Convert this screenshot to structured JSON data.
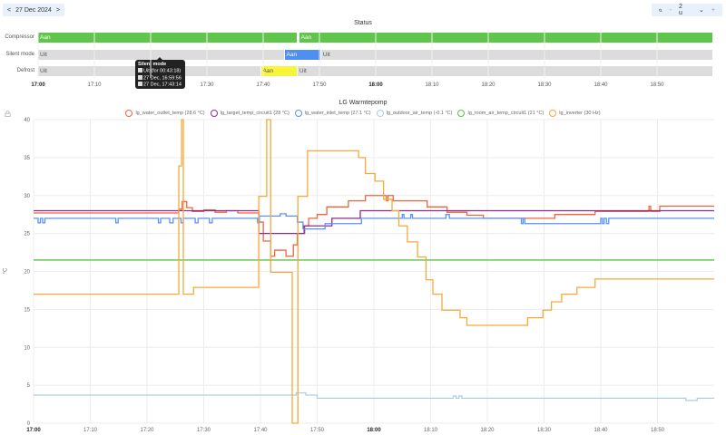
{
  "date_nav": {
    "prev": "<",
    "date": "27 Dec 2024",
    "next": ">"
  },
  "zoom_ctl": {
    "icon": "zoom-icon",
    "range": "2 u",
    "minus": "-",
    "chevron": "⌄",
    "plus": "+"
  },
  "status": {
    "title": "Status",
    "axis_ticks": [
      "17:00",
      "17:10",
      "17:20",
      "17:30",
      "17:40",
      "17:50",
      "18:00",
      "18:10",
      "18:20",
      "18:30",
      "18:40",
      "18:50"
    ],
    "rows": [
      {
        "label": "Compressor",
        "segments": [
          {
            "start": 0,
            "end": 46.2,
            "state": "Aan",
            "color": "#5fc54b"
          },
          {
            "start": 46.4,
            "end": 120,
            "state": "Aan",
            "color": "#5fc54b"
          }
        ]
      },
      {
        "label": "Silent mode",
        "segments": [
          {
            "start": 0,
            "end": 43.8,
            "state": "Uit",
            "color": "#dcdcdc"
          },
          {
            "start": 43.8,
            "end": 50.3,
            "state": "Aan",
            "color": "#4e8ff0"
          },
          {
            "start": 50.3,
            "end": 120,
            "state": "Uit",
            "color": "#dcdcdc"
          }
        ]
      },
      {
        "label": "Defrost",
        "segments": [
          {
            "start": 0,
            "end": 39.6,
            "state": "Uit",
            "color": "#dcdcdc"
          },
          {
            "start": 39.6,
            "end": 46.1,
            "state": "Aan",
            "color": "#f7f53a"
          },
          {
            "start": 46.1,
            "end": 120,
            "state": "Uit",
            "color": "#dcdcdc"
          }
        ]
      }
    ],
    "tooltip": {
      "title": "Silent mode",
      "line1": "Uit  (for 00:43:18)",
      "line2": "27 Dec, 16:59:56",
      "line3": "27 Dec, 17:43:14"
    }
  },
  "chart_data": {
    "type": "line",
    "title": "LG Warmtepomp",
    "ylabel": "°C",
    "xlabel": "",
    "x_unit": "minutes after 17:00",
    "xlim": [
      0,
      120
    ],
    "ylim": [
      0,
      40
    ],
    "yticks": [
      "0",
      "5",
      "10",
      "15",
      "20",
      "25",
      "30",
      "35",
      "40"
    ],
    "xticks": [
      "17:00",
      "17:10",
      "17:20",
      "17:30",
      "17:40",
      "17:50",
      "18:00",
      "18:10",
      "18:20",
      "18:30",
      "18:40",
      "18:50"
    ],
    "grid": true,
    "legend_position": "top",
    "series": [
      {
        "name": "lg_water_outlet_temp (28.6 °C)",
        "color": "#f0643c",
        "points": [
          [
            0,
            27.7
          ],
          [
            25.6,
            28.2
          ],
          [
            26.2,
            29.2
          ],
          [
            27,
            28.4
          ],
          [
            28,
            27.9
          ],
          [
            30,
            28.1
          ],
          [
            32,
            27.8
          ],
          [
            34,
            28
          ],
          [
            36,
            27.7
          ],
          [
            39.7,
            26.5
          ],
          [
            40.5,
            24
          ],
          [
            41.8,
            22
          ],
          [
            42.5,
            22.8
          ],
          [
            44.5,
            22
          ],
          [
            45.8,
            23.5
          ],
          [
            46.5,
            25
          ],
          [
            47.8,
            26
          ],
          [
            48.5,
            27
          ],
          [
            50,
            27.5
          ],
          [
            51.7,
            28.5
          ],
          [
            55.5,
            29.3
          ],
          [
            58.5,
            30
          ],
          [
            62.2,
            29.3
          ],
          [
            62.5,
            30
          ],
          [
            63.4,
            29.3
          ],
          [
            69.4,
            28.5
          ],
          [
            72.9,
            27.8
          ],
          [
            76.4,
            27.4
          ],
          [
            79.3,
            27
          ],
          [
            91.9,
            27.5
          ],
          [
            99,
            27.9
          ],
          [
            108.5,
            28.6
          ],
          [
            108.8,
            27.9
          ],
          [
            110.4,
            28.6
          ]
        ]
      },
      {
        "name": "lg_target_temp_circuit1 (28 °C)",
        "color": "#8e2c8e",
        "points": [
          [
            0,
            28
          ],
          [
            39.7,
            25
          ],
          [
            47.7,
            26
          ],
          [
            52.6,
            27
          ],
          [
            57.6,
            28
          ]
        ]
      },
      {
        "name": "lg_water_inlet_temp (27.1 °C)",
        "color": "#5b93f0",
        "points": [
          [
            0,
            27
          ],
          [
            0.8,
            26.4
          ],
          [
            1.2,
            27
          ],
          [
            1.6,
            26.4
          ],
          [
            2,
            27
          ],
          [
            14.5,
            26.4
          ],
          [
            14.9,
            27
          ],
          [
            22,
            26.4
          ],
          [
            22.4,
            27
          ],
          [
            24,
            26.4
          ],
          [
            24.6,
            27
          ],
          [
            26,
            26.4
          ],
          [
            26.4,
            27
          ],
          [
            28.5,
            26.4
          ],
          [
            29,
            27
          ],
          [
            31,
            26.4
          ],
          [
            31.5,
            27
          ],
          [
            39.5,
            26.4
          ],
          [
            39.8,
            27.3
          ],
          [
            43.5,
            27.6
          ],
          [
            44.5,
            27.3
          ],
          [
            46.5,
            26.5
          ],
          [
            47.5,
            25.6
          ],
          [
            51.4,
            26.3
          ],
          [
            57.8,
            27
          ],
          [
            65,
            27.5
          ],
          [
            65.3,
            27
          ],
          [
            66.5,
            27.5
          ],
          [
            66.8,
            27
          ],
          [
            72.7,
            27.5
          ],
          [
            73.3,
            27
          ],
          [
            86,
            26.3
          ],
          [
            86.3,
            27
          ],
          [
            86.6,
            26.3
          ],
          [
            100,
            27
          ],
          [
            100.3,
            26.3
          ],
          [
            100.6,
            27
          ],
          [
            101,
            26.3
          ],
          [
            101.4,
            27
          ]
        ]
      },
      {
        "name": "lg_outdoor_air_temp (-0.1 °C)",
        "color": "#a9cfe0",
        "points": [
          [
            0,
            3.7
          ],
          [
            46.3,
            4.0
          ],
          [
            48,
            3.7
          ],
          [
            50,
            3.3
          ],
          [
            74,
            3.6
          ],
          [
            74.5,
            3.3
          ],
          [
            75,
            3.6
          ],
          [
            75.5,
            3.3
          ],
          [
            115,
            3.0
          ],
          [
            117,
            3.3
          ]
        ]
      },
      {
        "name": "lg_room_air_temp_circuit1 (21 °C)",
        "color": "#5cc04a",
        "points": [
          [
            0,
            21.5
          ]
        ]
      },
      {
        "name": "lg_inverter (30 Hz)",
        "color": "#f6a93b",
        "points": [
          [
            0,
            17
          ],
          [
            25.6,
            33.9
          ],
          [
            26.1,
            40
          ],
          [
            26.4,
            17
          ],
          [
            28.2,
            17.9
          ],
          [
            39.7,
            29.9
          ],
          [
            41.1,
            40
          ],
          [
            41.8,
            19.9
          ],
          [
            45.6,
            0
          ],
          [
            46.6,
            29.9
          ],
          [
            48.3,
            35.9
          ],
          [
            57.3,
            35
          ],
          [
            58.5,
            32.9
          ],
          [
            60.2,
            31.9
          ],
          [
            61.7,
            29.5
          ],
          [
            63.2,
            28
          ],
          [
            64.4,
            26
          ],
          [
            65.9,
            23.9
          ],
          [
            67.7,
            21.9
          ],
          [
            69.2,
            18.9
          ],
          [
            70.4,
            17
          ],
          [
            72,
            14.9
          ],
          [
            75.2,
            13.9
          ],
          [
            76.4,
            12.9
          ],
          [
            87.1,
            13.9
          ],
          [
            89.8,
            14.9
          ],
          [
            91.3,
            16
          ],
          [
            93.1,
            17
          ],
          [
            95.8,
            17.9
          ],
          [
            99,
            19
          ]
        ]
      }
    ]
  }
}
